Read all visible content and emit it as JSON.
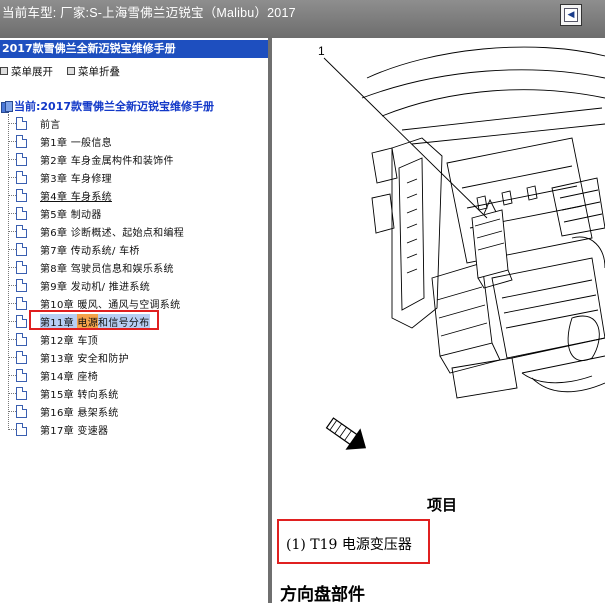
{
  "header": {
    "vehicle_label": "当前车型:   厂家:S-上海雪佛兰迈锐宝（Malibu）2017",
    "nav_icon": "page-nav-icon"
  },
  "sidebar": {
    "title": "2017款雪佛兰全新迈锐宝维修手册",
    "expand_label": "菜单展开",
    "collapse_label": "菜单折叠",
    "current_label": "当前:2017款雪佛兰全新迈锐宝维修手册",
    "items": [
      {
        "label": "前言"
      },
      {
        "label": "第1章 一般信息"
      },
      {
        "label": "第2章 车身金属构件和装饰件"
      },
      {
        "label": "第3章 车身修理"
      },
      {
        "label": "第4章 车身系统"
      },
      {
        "label": "第5章 制动器"
      },
      {
        "label": "第6章 诊断概述、起始点和编程"
      },
      {
        "label": "第7章 传动系统/ 车桥"
      },
      {
        "label": "第8章 驾驶员信息和娱乐系统"
      },
      {
        "label": "第9章 发动机/ 推进系统"
      },
      {
        "label": "第10章 暖风、通风与空调系统"
      },
      {
        "label": "第11章 电源和信号分布"
      },
      {
        "label": "第12章 车顶"
      },
      {
        "label": "第13章 安全和防护"
      },
      {
        "label": "第14章 座椅"
      },
      {
        "label": "第15章 转向系统"
      },
      {
        "label": "第16章 悬架系统"
      },
      {
        "label": "第17章 变速器"
      }
    ],
    "selected_chapter_prefix": "第11章 ",
    "selected_chapter_highlight": "电源",
    "selected_chapter_rest": "和信号分布"
  },
  "content": {
    "callout_number": "1",
    "item_heading": "项目",
    "component_label": "(1) T19 电源变压器",
    "section_heading": "方向盘部件"
  },
  "colors": {
    "title_bar": "#1e4fbf",
    "highlight_box": "#e02020",
    "highlight_fill": "#f6a24a",
    "selected_bg": "#b8cff4"
  }
}
